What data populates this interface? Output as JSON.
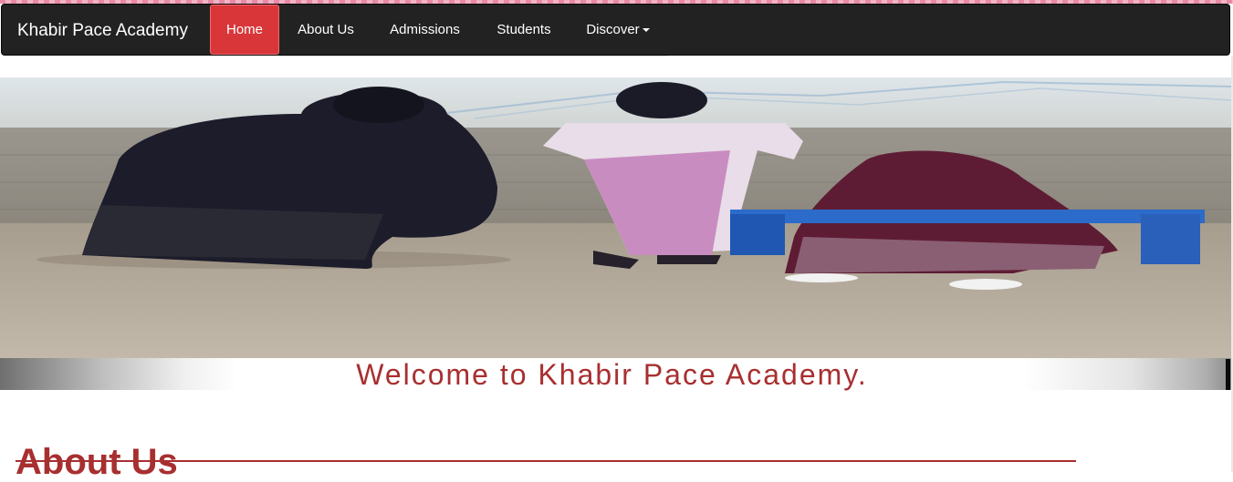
{
  "navbar": {
    "brand": "Khabir Pace Academy",
    "items": [
      {
        "label": "Home",
        "active": true
      },
      {
        "label": "About Us"
      },
      {
        "label": "Admissions"
      },
      {
        "label": "Students"
      },
      {
        "label": "Discover"
      }
    ]
  },
  "banner": {
    "welcome_text": "Welcome to Khabir Pace Academy."
  },
  "about": {
    "heading": "About Us"
  },
  "colors": {
    "navbar_bg": "#222222",
    "active_nav": "#d9363a",
    "accent": "#a82f30"
  }
}
